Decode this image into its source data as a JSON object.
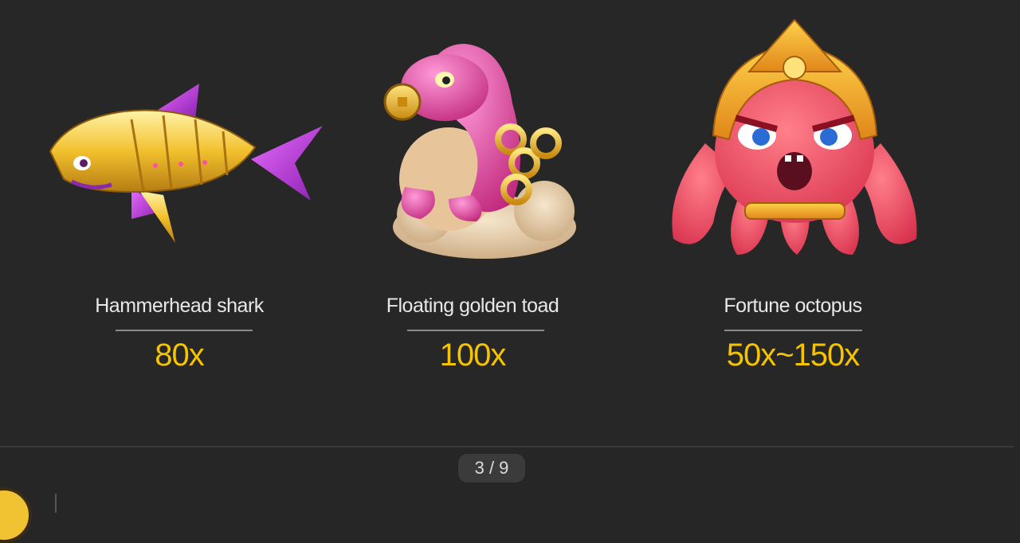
{
  "cards": [
    {
      "name": "Hammerhead shark",
      "multiplier": "80x"
    },
    {
      "name": "Floating golden toad",
      "multiplier": "100x"
    },
    {
      "name": "Fortune octopus",
      "multiplier": "50x~150x"
    }
  ],
  "pager": {
    "label": "3 / 9"
  },
  "colors": {
    "background": "#262626",
    "multiplier": "#f5c400",
    "name": "#e8e8e8",
    "divider": "#8a8a8a"
  }
}
